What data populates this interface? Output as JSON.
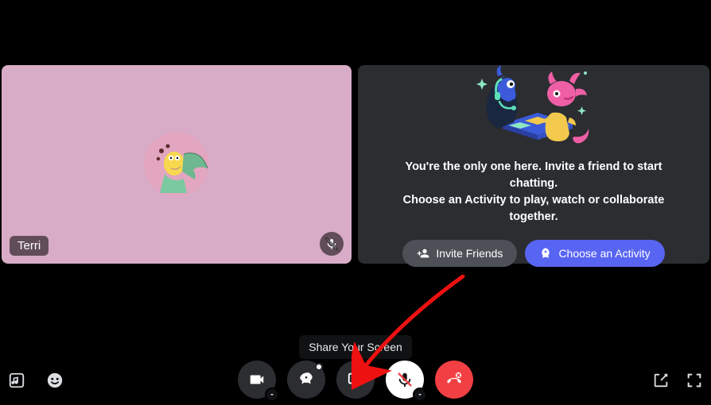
{
  "participant": {
    "name": "Terri",
    "muted": true
  },
  "empty_state": {
    "line1": "You're the only one here. Invite a friend to start chatting.",
    "line2": "Choose an Activity to play, watch or collaborate together.",
    "invite_label": "Invite Friends",
    "activity_label": "Choose an Activity"
  },
  "tooltip": {
    "share_screen": "Share Your Screen"
  },
  "controls": {
    "camera": "camera",
    "activities": "rocket",
    "share_screen": "screen-share",
    "mic_muted": "mic-muted",
    "disconnect": "phone-hangup"
  },
  "left_icons": {
    "soundboard": "music-note",
    "emoji": "smile"
  },
  "right_icons": {
    "popout": "popout",
    "fullscreen": "fullscreen"
  }
}
